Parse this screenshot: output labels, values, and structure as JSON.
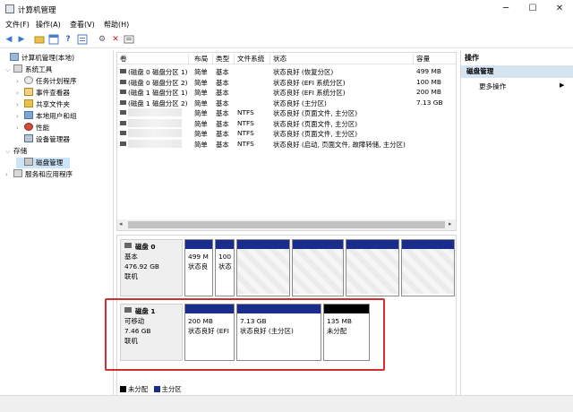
{
  "window": {
    "title": "计算机管理"
  },
  "window_controls": {
    "minimize": "─",
    "maximize": "☐",
    "close": "✕"
  },
  "menu": {
    "items": [
      "文件(F)",
      "操作(A)",
      "查看(V)",
      "帮助(H)"
    ]
  },
  "toolbar": {
    "icons": [
      "back-icon",
      "forward-icon",
      "folder-icon",
      "console-icon",
      "help-icon",
      "properties-icon",
      "connect-icon",
      "delete-icon",
      "export-icon"
    ]
  },
  "tree": {
    "items": [
      {
        "label": "计算机管理(本地)",
        "level": 0,
        "expanded": true
      },
      {
        "label": "系统工具",
        "level": 1,
        "expanded": true
      },
      {
        "label": "任务计划程序",
        "level": 2
      },
      {
        "label": "事件查看器",
        "level": 2
      },
      {
        "label": "共享文件夹",
        "level": 2
      },
      {
        "label": "本地用户和组",
        "level": 2
      },
      {
        "label": "性能",
        "level": 2
      },
      {
        "label": "设备管理器",
        "level": 2
      },
      {
        "label": "存储",
        "level": 1,
        "expanded": true
      },
      {
        "label": "磁盘管理",
        "level": 2,
        "selected": true
      },
      {
        "label": "服务和应用程序",
        "level": 1
      }
    ]
  },
  "volumes": {
    "headers": [
      "卷",
      "布局",
      "类型",
      "文件系统",
      "状态",
      "容量"
    ],
    "rows": [
      {
        "name": "(磁盘 0 磁盘分区 1)",
        "layout": "简单",
        "type": "基本",
        "fs": "",
        "status": "状态良好 (恢复分区)",
        "cap": "499 MB"
      },
      {
        "name": "(磁盘 0 磁盘分区 2)",
        "layout": "简单",
        "type": "基本",
        "fs": "",
        "status": "状态良好 (EFI 系统分区)",
        "cap": "100 MB"
      },
      {
        "name": "(磁盘 1 磁盘分区 1)",
        "layout": "简单",
        "type": "基本",
        "fs": "",
        "status": "状态良好 (EFI 系统分区)",
        "cap": "200 MB"
      },
      {
        "name": "(磁盘 1 磁盘分区 2)",
        "layout": "简单",
        "type": "基本",
        "fs": "",
        "status": "状态良好 (主分区)",
        "cap": "7.13 GB"
      },
      {
        "name": "",
        "layout": "简单",
        "type": "基本",
        "fs": "NTFS",
        "status": "状态良好 (页面文件, 主分区)",
        "cap": ""
      },
      {
        "name": "",
        "layout": "简单",
        "type": "基本",
        "fs": "NTFS",
        "status": "状态良好 (页面文件, 主分区)",
        "cap": ""
      },
      {
        "name": "",
        "layout": "简单",
        "type": "基本",
        "fs": "NTFS",
        "status": "状态良好 (页面文件, 主分区)",
        "cap": ""
      },
      {
        "name": "",
        "layout": "简单",
        "type": "基本",
        "fs": "NTFS",
        "status": "状态良好 (启动, 页面文件, 故障转储, 主分区)",
        "cap": ""
      }
    ]
  },
  "disks": {
    "disk0": {
      "name": "磁盘 0",
      "kind": "基本",
      "size": "476.92 GB",
      "state": "联机",
      "p1_line1": "499 M",
      "p1_line2": "状态良",
      "p2_line1": "100",
      "p2_line2": "状态"
    },
    "disk1": {
      "name": "磁盘 1",
      "kind": "可移动",
      "size": "7.46 GB",
      "state": "联机",
      "p1_line1": "200 MB",
      "p1_line2": "状态良好 (EFI",
      "p2_line1": "7.13 GB",
      "p2_line2": "状态良好 (主分区)",
      "p3_line1": "135 MB",
      "p3_line2": "未分配"
    }
  },
  "legend": {
    "unallocated": "未分配",
    "primary": "主分区"
  },
  "actions": {
    "title": "操作",
    "section": "磁盘管理",
    "more": "更多操作"
  },
  "colors": {
    "primary_partition": "#1a2c8c",
    "unallocated": "#000000",
    "highlight": "#d23030",
    "selection": "#cce4f7"
  }
}
